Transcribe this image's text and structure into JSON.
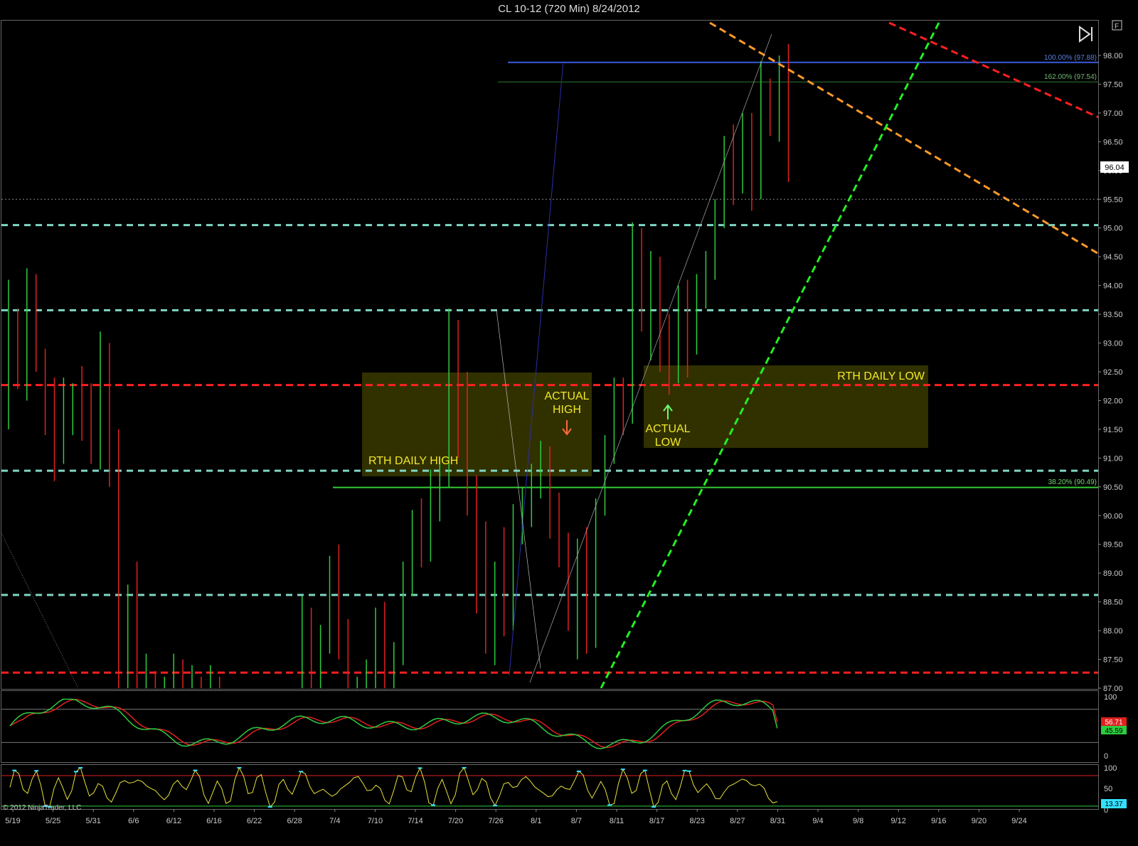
{
  "window": {
    "title": "CL 10-12 (720 Min)  8/24/2012",
    "copyright": "© 2012 NinjaTrader, LLC",
    "f_button": "F"
  },
  "colors": {
    "bg": "#000000",
    "up": "#2ecc40",
    "down": "#e02020",
    "fib": "#3a5bd9",
    "aqua": "#7fd6c4",
    "redline": "#ff2020",
    "orange": "#ff9a2a",
    "greenline": "#22ee22",
    "zone": "#5a5a00",
    "annotation": "#f2e82a",
    "stoch_d": "#e02020",
    "stoch_k": "#2ecc40",
    "rsi": "#e8e03a",
    "rsi_hi": "#33e0ff"
  },
  "price_axis": {
    "ticks": [
      "98.00",
      "97.50",
      "97.00",
      "96.50",
      "96.00",
      "95.50",
      "95.00",
      "94.50",
      "94.00",
      "93.50",
      "93.00",
      "92.50",
      "92.00",
      "91.50",
      "91.00",
      "90.50",
      "90.00",
      "89.50",
      "89.00",
      "88.50",
      "88.00",
      "87.50",
      "87.00"
    ],
    "last_price": "96.04"
  },
  "date_axis": [
    "5/19",
    "5/25",
    "5/31",
    "6/6",
    "6/12",
    "6/16",
    "6/22",
    "6/28",
    "7/4",
    "7/10",
    "7/14",
    "7/20",
    "7/26",
    "8/1",
    "8/7",
    "8/11",
    "8/17",
    "8/23",
    "8/27",
    "8/31",
    "9/4",
    "9/8",
    "9/12",
    "9/16",
    "9/20",
    "9/24"
  ],
  "fib_labels": {
    "top": "100.00% (97.88)",
    "ext": "162.00% (97.54)",
    "mid": "38.20% (90.49)"
  },
  "annotations": {
    "rth_high": "RTH DAILY HIGH",
    "rth_low": "RTH DAILY LOW",
    "actual_high_1": "ACTUAL",
    "actual_high_2": "HIGH",
    "actual_low_1": "ACTUAL",
    "actual_low_2": "LOW"
  },
  "stoch_panel": {
    "ticks": [
      "100",
      "0"
    ],
    "value_d": "56.71",
    "value_k": "45.59"
  },
  "rsi_panel": {
    "ticks": [
      "100",
      "50",
      "0"
    ],
    "value": "13.37"
  },
  "levels": {
    "aqua": [
      95.05,
      93.57,
      90.78,
      88.62
    ],
    "red": [
      92.27,
      87.27
    ],
    "blue_fib": 97.88,
    "green_fib": 97.54,
    "green_mid": 90.49,
    "dotted": 95.5
  },
  "chart_data": {
    "type": "ohlc",
    "title": "CL 10-12 (720 Min)  8/24/2012",
    "ylim": [
      87.0,
      98.3
    ],
    "bars": [
      [
        92.6,
        94.1,
        91.5,
        93.0
      ],
      [
        93.0,
        93.6,
        92.2,
        92.6
      ],
      [
        92.6,
        94.3,
        92.0,
        93.9
      ],
      [
        93.9,
        94.2,
        92.5,
        92.8
      ],
      [
        92.8,
        92.9,
        91.4,
        91.8
      ],
      [
        91.8,
        92.4,
        90.6,
        91.3
      ],
      [
        91.3,
        92.4,
        90.9,
        92.0
      ],
      [
        92.0,
        92.3,
        91.4,
        92.1
      ],
      [
        92.1,
        92.6,
        91.3,
        91.8
      ],
      [
        91.8,
        92.3,
        90.9,
        91.0
      ],
      [
        91.0,
        93.2,
        90.8,
        92.7
      ],
      [
        92.7,
        93.0,
        90.5,
        90.9
      ],
      [
        90.9,
        91.5,
        86.6,
        87.3
      ],
      [
        87.3,
        88.8,
        86.4,
        87.9
      ],
      [
        87.9,
        89.2,
        86.2,
        86.8
      ],
      [
        86.8,
        87.6,
        86.3,
        87.2
      ],
      [
        87.2,
        87.3,
        86.8,
        86.9
      ],
      [
        86.9,
        87.2,
        86.5,
        87.0
      ],
      [
        87.0,
        87.6,
        86.4,
        87.3
      ],
      [
        87.3,
        87.5,
        86.7,
        86.9
      ],
      [
        86.9,
        87.4,
        86.6,
        87.1
      ],
      [
        87.1,
        87.2,
        86.6,
        86.8
      ],
      [
        86.8,
        87.4,
        86.5,
        87.1
      ],
      [
        87.1,
        87.2,
        86.4,
        86.6
      ],
      [
        86.6,
        86.9,
        86.2,
        86.7
      ],
      [
        86.7,
        86.9,
        86.2,
        86.6
      ],
      [
        86.6,
        86.9,
        86.3,
        86.5
      ],
      [
        86.5,
        86.7,
        86.1,
        86.3
      ],
      [
        86.3,
        86.6,
        86.0,
        86.4
      ],
      [
        86.4,
        86.7,
        86.1,
        86.5
      ],
      [
        86.5,
        86.7,
        86.2,
        86.3
      ],
      [
        86.3,
        86.6,
        86.0,
        86.4
      ],
      [
        86.4,
        88.6,
        86.3,
        88.2
      ],
      [
        88.2,
        88.4,
        86.8,
        87.5
      ],
      [
        87.5,
        88.1,
        86.8,
        87.9
      ],
      [
        87.9,
        89.3,
        87.6,
        88.9
      ],
      [
        88.9,
        89.5,
        87.5,
        87.8
      ],
      [
        87.8,
        88.2,
        86.5,
        86.9
      ],
      [
        86.9,
        87.2,
        86.6,
        87.0
      ],
      [
        87.0,
        87.5,
        86.7,
        87.3
      ],
      [
        87.3,
        88.4,
        87.0,
        88.1
      ],
      [
        88.1,
        88.5,
        86.9,
        87.2
      ],
      [
        87.2,
        87.8,
        86.8,
        87.6
      ],
      [
        87.6,
        89.2,
        87.4,
        88.9
      ],
      [
        88.9,
        90.1,
        88.6,
        89.8
      ],
      [
        89.8,
        90.3,
        89.1,
        89.4
      ],
      [
        89.4,
        90.8,
        89.2,
        90.5
      ],
      [
        90.5,
        91.0,
        89.9,
        90.8
      ],
      [
        90.8,
        93.6,
        90.5,
        92.8
      ],
      [
        92.8,
        93.4,
        91.0,
        91.5
      ],
      [
        91.5,
        92.5,
        90.0,
        90.4
      ],
      [
        90.4,
        90.7,
        88.3,
        88.8
      ],
      [
        88.8,
        89.9,
        87.6,
        87.9
      ],
      [
        87.9,
        89.2,
        87.4,
        89.0
      ],
      [
        89.0,
        89.8,
        87.9,
        88.1
      ],
      [
        88.1,
        90.2,
        88.0,
        89.9
      ],
      [
        89.9,
        90.5,
        89.5,
        90.2
      ],
      [
        90.2,
        90.9,
        89.8,
        90.6
      ],
      [
        90.6,
        91.3,
        90.3,
        91.0
      ],
      [
        91.0,
        91.2,
        89.6,
        89.8
      ],
      [
        89.8,
        90.4,
        89.1,
        89.4
      ],
      [
        89.4,
        89.7,
        88.0,
        88.4
      ],
      [
        88.4,
        89.6,
        87.5,
        89.3
      ],
      [
        89.3,
        89.8,
        87.6,
        87.8
      ],
      [
        87.8,
        90.3,
        87.7,
        90.1
      ],
      [
        90.1,
        91.4,
        90.0,
        91.2
      ],
      [
        91.2,
        92.4,
        90.9,
        92.1
      ],
      [
        92.1,
        92.4,
        91.4,
        91.8
      ],
      [
        91.8,
        95.1,
        91.6,
        94.7
      ],
      [
        94.7,
        95.0,
        93.2,
        93.5
      ],
      [
        93.5,
        94.6,
        92.7,
        94.2
      ],
      [
        94.2,
        94.5,
        92.5,
        92.9
      ],
      [
        92.9,
        93.5,
        92.1,
        92.7
      ],
      [
        92.7,
        94.0,
        92.3,
        93.8
      ],
      [
        93.8,
        94.1,
        92.4,
        93.0
      ],
      [
        93.0,
        94.2,
        92.8,
        93.9
      ],
      [
        93.9,
        94.6,
        93.6,
        94.3
      ],
      [
        94.3,
        95.5,
        94.1,
        95.3
      ],
      [
        95.3,
        96.6,
        95.0,
        96.2
      ],
      [
        96.2,
        96.8,
        95.4,
        95.8
      ],
      [
        95.8,
        97.0,
        95.6,
        96.7
      ],
      [
        96.7,
        97.0,
        95.3,
        95.6
      ],
      [
        95.6,
        97.9,
        95.5,
        97.4
      ],
      [
        97.4,
        97.6,
        96.6,
        97.0
      ],
      [
        97.0,
        98.0,
        96.5,
        97.6
      ],
      [
        97.6,
        98.2,
        95.8,
        96.04
      ]
    ]
  }
}
